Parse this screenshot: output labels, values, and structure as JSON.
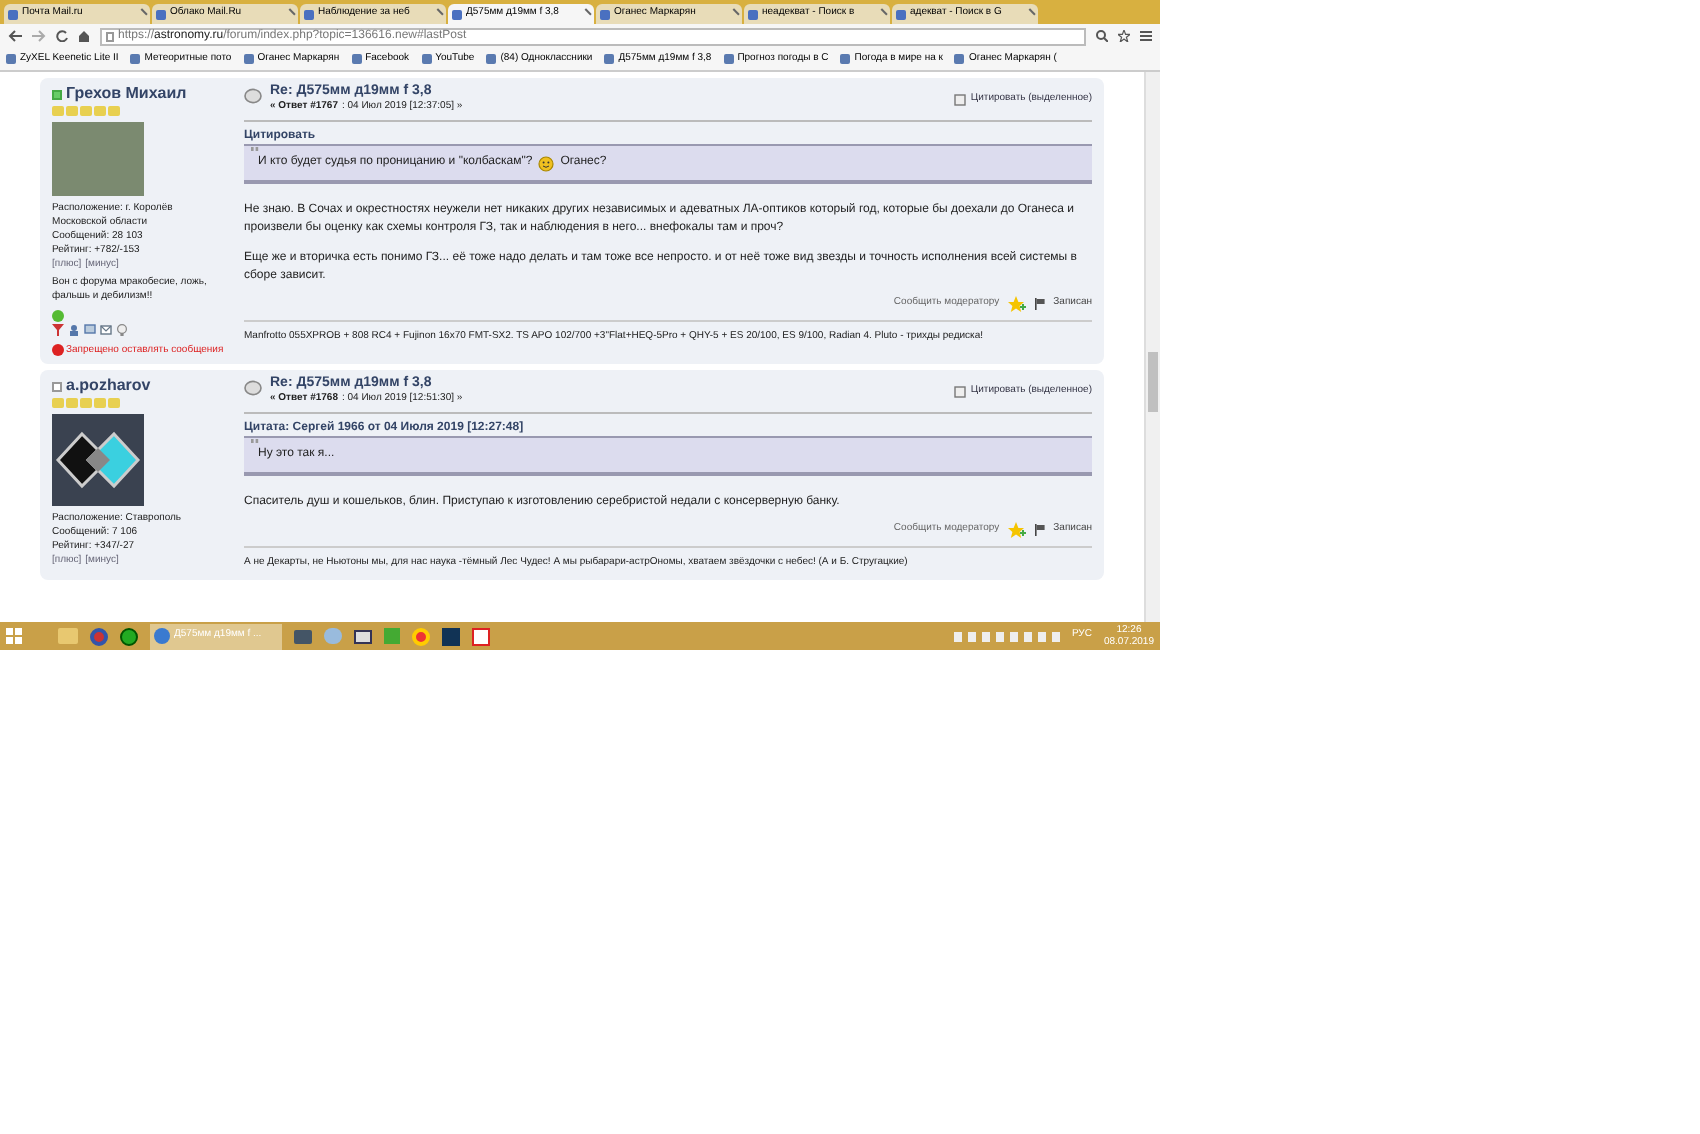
{
  "browser": {
    "tabs": [
      {
        "label": "Почта Mail.ru",
        "selected": false
      },
      {
        "label": "Облако Mail.Ru",
        "selected": false
      },
      {
        "label": "Наблюдение за неб",
        "selected": false
      },
      {
        "label": "Д575мм д19мм f 3,8",
        "selected": true
      },
      {
        "label": "Оганес Маркарян",
        "selected": false
      },
      {
        "label": "неадекват - Поиск в",
        "selected": false
      },
      {
        "label": "адекват - Поиск в G",
        "selected": false
      }
    ],
    "url_prefix": "https://",
    "url_host": "astronomy.ru",
    "url_path": "/forum/index.php?topic=136616.new#lastPost",
    "bookmarks": [
      "ZyXEL Keenetic Lite II",
      "Метеоритные пото",
      "Оганес Маркарян",
      "Facebook",
      "YouTube",
      "(84) Одноклассники",
      "Д575мм д19мм f 3,8",
      "Прогноз погоды в С",
      "Погода в мире на к",
      "Оганес Маркарян ("
    ]
  },
  "posts": [
    {
      "author": "Грехов Михаил",
      "online": true,
      "stars": 5,
      "avatar": {
        "kind": "photo"
      },
      "profile": [
        "Расположение: г. Королёв Московской области",
        "Сообщений: 28 103",
        "Рейтинг: +782/-153"
      ],
      "vote_links": [
        "[плюс]",
        "[минус]"
      ],
      "user_signature": "Вон с форума мракобесие, ложь, фальшь и дебилизм!!",
      "banned": true,
      "banned_text": "Запрещено оставлять сообщения",
      "title": "Re: Д575мм д19мм f 3,8",
      "reply_label": "« Ответ #1767",
      "date": ": 04 Июл 2019 [12:37:05] »",
      "quote_selected": "Цитировать (выделенное)",
      "quote_header": "Цитировать",
      "quote_text": "И кто будет судья по проницанию и \"колбаскам\"?",
      "quote_smiley": true,
      "quote_after": "Оганес?",
      "body": [
        "Не знаю. В Сочах и окрестностях неужели нет никаких других независимых и адеватных ЛА-оптиков который год, которые бы доехали до Оганеса и произвели бы оценку как схемы контроля ГЗ, так и наблюдения в него... внефокалы там и проч?",
        "Еще же и вторичка есть понимо ГЗ... её тоже надо делать и там тоже все непросто. и от неё тоже вид звезды и точность исполнения всей системы в сборе зависит."
      ],
      "report": "Сообщить модератору",
      "logged": "Записан",
      "signature": "Manfrotto 055XPROB + 808 RC4 + Fujinon 16x70 FMT-SX2. TS APO 102/700 +3\"Flat+HEQ-5Pro + QHY-5 + ES 20/100, ES 9/100, Radian 4. Pluto - трихды редиска!"
    },
    {
      "author": "a.pozharov",
      "online": false,
      "stars": 5,
      "avatar": {
        "kind": "logo"
      },
      "profile": [
        "Расположение: Ставрополь",
        "Сообщений: 7 106",
        "Рейтинг: +347/-27"
      ],
      "vote_links": [
        "[плюс]",
        "[минус]"
      ],
      "banned": false,
      "title": "Re: Д575мм д19мм f 3,8",
      "reply_label": "« Ответ #1768",
      "date": ": 04 Июл 2019 [12:51:30] »",
      "quote_selected": "Цитировать (выделенное)",
      "quote_header": "Цитата: Сергей 1966 от 04 Июля 2019 [12:27:48]",
      "quote_text": "Ну это так я...",
      "quote_smiley": false,
      "body": [
        "Спаситель душ и кошельков, блин. Приступаю к изготовлению серебристой недали с консерверную банку."
      ],
      "report": "Сообщить модератору",
      "logged": "Записан",
      "signature": "А не Декарты, не Ньютоны мы, для нас наука -тёмный Лес Чудес! А мы рыбарари-астрОномы, хватаем звёздочки с небес! (А и Б. Стругацкие)"
    }
  ],
  "taskbar": {
    "active_window": "Д575мм д19мм f ...",
    "language": "РУС",
    "time": "12:26",
    "date": "08.07.2019"
  }
}
